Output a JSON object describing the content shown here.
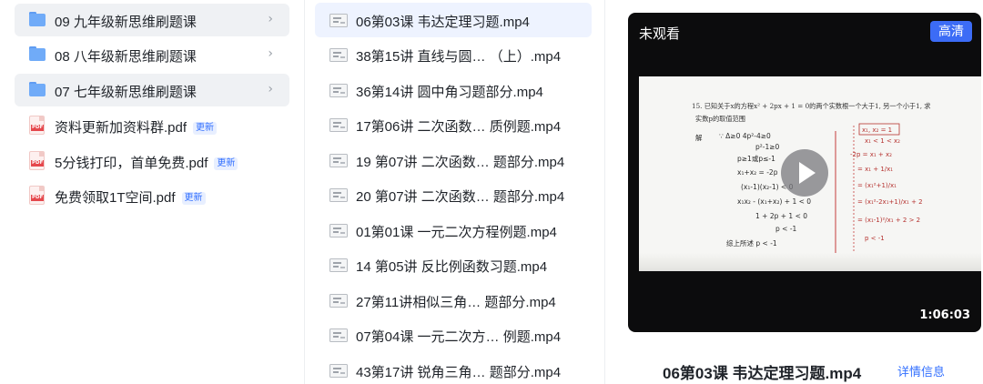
{
  "folders": [
    {
      "label": "09 九年级新思维刷题课"
    },
    {
      "label": "08 八年级新思维刷题课"
    },
    {
      "label": "07 七年级新思维刷题课"
    }
  ],
  "files": [
    {
      "label": "资料更新加资料群.pdf",
      "badge": "更新"
    },
    {
      "label": "5分钱打印，首单免费.pdf",
      "badge": "更新"
    },
    {
      "label": "免费领取1T空间.pdf",
      "badge": "更新"
    }
  ],
  "file_type_label": "PDF",
  "chevron_icon": "chevron-right-icon",
  "videos": [
    {
      "label": "06第03课 韦达定理习题.mp4"
    },
    {
      "label": "38第15讲 直线与圆…  （上）.mp4"
    },
    {
      "label": "36第14讲 圆中角习题部分.mp4"
    },
    {
      "label": "17第06讲 二次函数…  质例题.mp4"
    },
    {
      "label": "19 第07讲 二次函数…  题部分.mp4"
    },
    {
      "label": "20 第07讲 二次函数…  题部分.mp4"
    },
    {
      "label": "01第01课 一元二次方程例题.mp4"
    },
    {
      "label": "14 第05讲 反比例函数习题.mp4"
    },
    {
      "label": "27第11讲相似三角…  题部分.mp4"
    },
    {
      "label": "07第04课 一元二次方…  例题.mp4"
    },
    {
      "label": "43第17讲 锐角三角…  题部分.mp4"
    }
  ],
  "player": {
    "status": "未观看",
    "quality": "高清",
    "duration": "1:06:03",
    "frame_text": {
      "problem_line1": "15. 已知关于x的方程x² + 2px + 1 = 0的两个实数根一个大于1, 另一个小于1, 求",
      "problem_line2": "实数p的取值范围",
      "w1": "解",
      "w2": "∵ Δ≥0    4p²-4≥0",
      "w3": "p²-1≥0",
      "w4": "p≥1或p≤-1",
      "w5": "x₁+x₂ = -2p",
      "w6": "(x₁-1)(x₂-1) < 0",
      "w7": "x₁x₂ - (x₁+x₂) + 1 < 0",
      "w8": "1 + 2p + 1 < 0",
      "w9": "p < -1",
      "w10": "综上所述  p < -1",
      "r1": "x₁, x₂ = 1",
      "r2": "x₁ < 1 < x₂",
      "r3": "-2p = x₁ + x₂",
      "r4": "= x₁ + 1/x₁",
      "r5": "= (x₁²+1)/x₁",
      "r6": "= (x₁²-2x₁+1)/x₁ + 2",
      "r7": "= (x₁-1)²/x₁ + 2 > 2",
      "r8": "p < -1"
    }
  },
  "now_playing_title": "06第03课 韦达定理习题.mp4",
  "detail_link": "详情信息",
  "colors": {
    "accent": "#3370ff",
    "selected_row": "#eff1f4",
    "selected_video": "#eef3ff",
    "quality_button": "#3c6cf6"
  }
}
